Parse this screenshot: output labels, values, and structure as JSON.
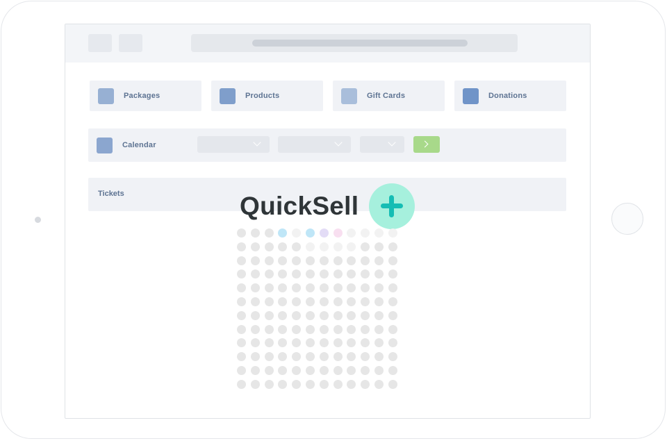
{
  "tiles": [
    {
      "label": "Packages",
      "icon": "package-icon",
      "color": "#97b0d3"
    },
    {
      "label": "Products",
      "icon": "product-icon",
      "color": "#7f9ecb"
    },
    {
      "label": "Gift Cards",
      "icon": "gift-card-icon",
      "color": "#a9bedb"
    },
    {
      "label": "Donations",
      "icon": "donation-icon",
      "color": "#7094c8"
    }
  ],
  "calendar": {
    "label": "Calendar",
    "icon": "calendar-icon",
    "color": "#8ba6cf"
  },
  "tickets": {
    "label": "Tickets"
  },
  "brand": {
    "name": "QuickSell",
    "accent": "#15bdb4",
    "accent_bg": "#a6f0dd"
  },
  "colors": {
    "go_button": "#a8d98a",
    "seat_default": "#e6e6e6",
    "seat_faded": "#f2f2f2",
    "seat_blue": "#bfe6f7",
    "seat_lavender": "#e3dcf6",
    "seat_pink": "#f8dff0"
  },
  "seat_map": {
    "rows": 12,
    "cols": 12,
    "highlighted": [
      {
        "row": 0,
        "col": 3,
        "color": "seat_blue"
      },
      {
        "row": 0,
        "col": 5,
        "color": "seat_blue"
      },
      {
        "row": 0,
        "col": 6,
        "color": "seat_lavender"
      },
      {
        "row": 0,
        "col": 7,
        "color": "seat_pink"
      }
    ]
  }
}
